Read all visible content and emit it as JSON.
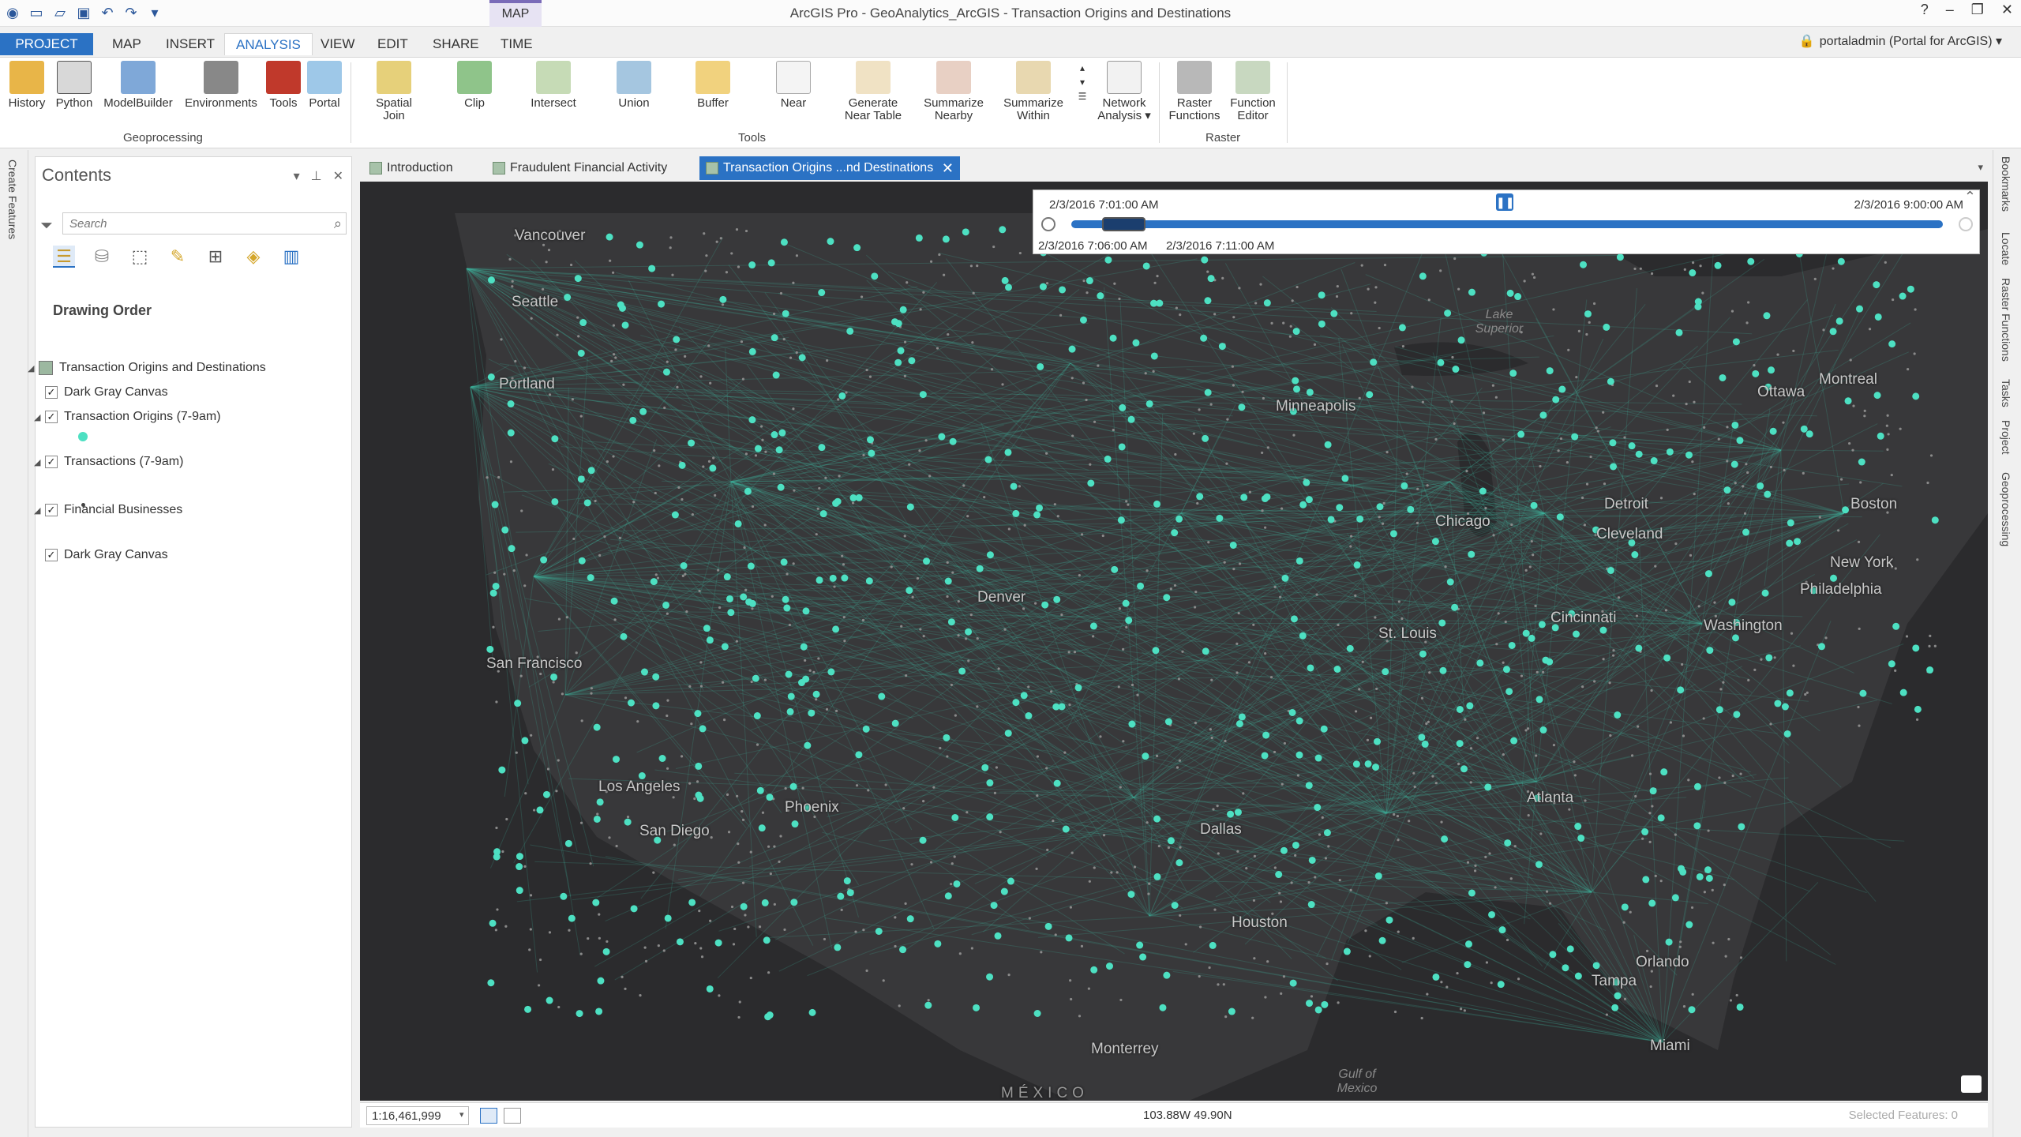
{
  "window": {
    "title": "ArcGIS Pro - GeoAnalytics_ArcGIS - Transaction Origins and Destinations",
    "context_tab": "MAP",
    "controls": [
      "?",
      "–",
      "❐",
      "✕"
    ]
  },
  "ribbon_tabs": [
    "PROJECT",
    "MAP",
    "INSERT",
    "ANALYSIS",
    "VIEW",
    "EDIT",
    "SHARE",
    "TIME"
  ],
  "user": "portaladmin (Portal for ArcGIS) ▾",
  "ribbon": {
    "geoprocessing": {
      "label": "Geoprocessing",
      "buttons": [
        "History",
        "Python",
        "ModelBuilder",
        "Environments",
        "Tools",
        "Portal"
      ]
    },
    "tools": {
      "label": "Tools",
      "buttons": [
        "Spatial\nJoin",
        "Clip",
        "Intersect",
        "Union",
        "Buffer",
        "Near",
        "Generate\nNear Table",
        "Summarize\nNearby",
        "Summarize\nWithin",
        "Network\nAnalysis ▾"
      ]
    },
    "raster": {
      "label": "Raster",
      "buttons": [
        "Raster\nFunctions",
        "Function\nEditor"
      ]
    }
  },
  "left_strip": "Create Features",
  "contents": {
    "title": "Contents",
    "search_placeholder": "Search",
    "drawing_order": "Drawing Order",
    "layers": {
      "map": "Transaction Origins and Destinations",
      "basemap1": "Dark Gray Canvas",
      "origins": "Transaction Origins (7-9am)",
      "transactions": "Transactions (7-9am)",
      "financial": "Financial Businesses",
      "basemap2": "Dark Gray Canvas"
    }
  },
  "view_tabs": [
    "Introduction",
    "Fraudulent Financial Activity",
    "Transaction Origins ...nd Destinations"
  ],
  "time_slider": {
    "start": "2/3/2016 7:01:00 AM",
    "end": "2/3/2016 9:00:00 AM",
    "current_start": "2/3/2016 7:06:00 AM",
    "current_end": "2/3/2016 7:11:00 AM",
    "window_fraction": [
      0.035,
      0.085
    ]
  },
  "map_labels": {
    "cities": [
      "Vancouver",
      "Seattle",
      "Portland",
      "Minneapolis",
      "Ottawa",
      "Montreal",
      "Chicago",
      "Detroit",
      "Cleveland",
      "Boston",
      "New York",
      "Philadelphia",
      "Washington",
      "Cincinnati",
      "St. Louis",
      "Denver",
      "San Francisco",
      "Los Angeles",
      "San Diego",
      "Phoenix",
      "Dallas",
      "Atlanta",
      "Houston",
      "Orlando",
      "Tampa",
      "Miami",
      "Monterrey"
    ],
    "water": [
      "Lake Superior",
      "Gulf of Mexico"
    ],
    "country": "MÉXICO"
  },
  "colors": {
    "accent": "#2b72c4",
    "points": "#4de0c2",
    "lines": "#3fb8a0",
    "map_bg": "#2b2b2d"
  },
  "status": {
    "scale": "1:16,461,999",
    "coordinates": "103.88W 49.90N",
    "selected": "Selected Features: 0"
  },
  "right_strip": [
    "Bookmarks",
    "Locate",
    "Raster Functions",
    "Tasks",
    "Project",
    "Geoprocessing"
  ]
}
